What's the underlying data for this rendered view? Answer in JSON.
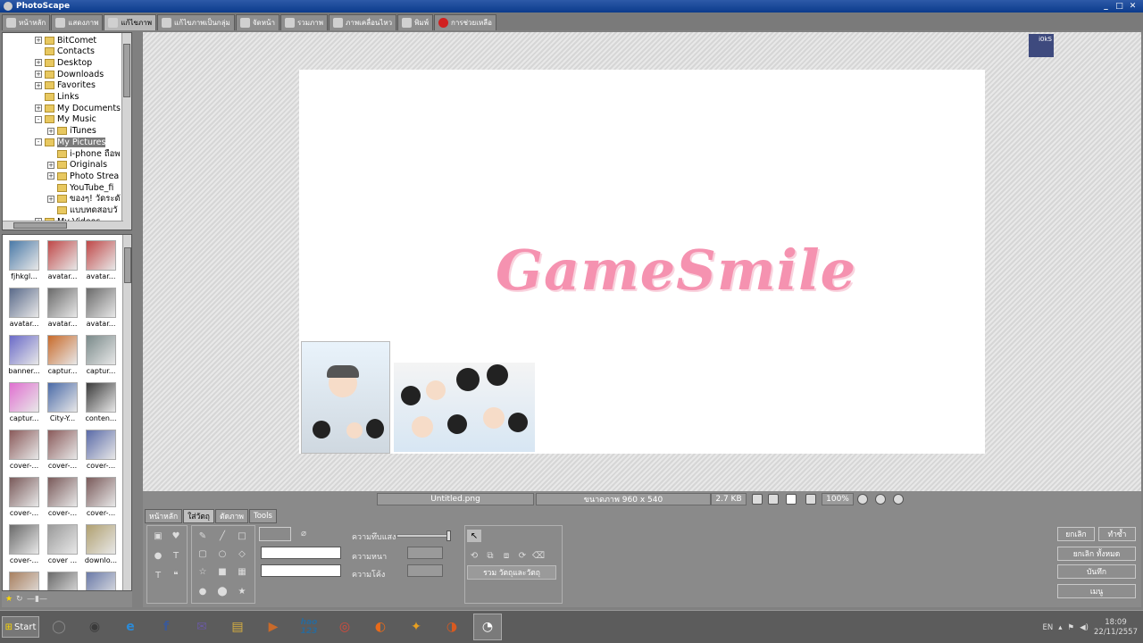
{
  "window": {
    "title": "PhotoScape",
    "controls": [
      "_",
      "□",
      "✕"
    ]
  },
  "main_tabs": [
    {
      "label": "หน้าหลัก",
      "icon": "home-icon"
    },
    {
      "label": "แสดงภาพ",
      "icon": "viewer-icon"
    },
    {
      "label": "แก้ไขภาพ",
      "icon": "editor-icon",
      "active": true
    },
    {
      "label": "แก้ไขภาพเป็นกลุ่ม",
      "icon": "batch-editor-icon"
    },
    {
      "label": "จัดหน้า",
      "icon": "page-icon"
    },
    {
      "label": "รวมภาพ",
      "icon": "combine-icon"
    },
    {
      "label": "ภาพเคลื่อนไหว",
      "icon": "animated-gif-icon"
    },
    {
      "label": "พิมพ์",
      "icon": "print-icon"
    },
    {
      "label": "การช่วยเหลือ",
      "icon": "help-icon"
    }
  ],
  "folder_tree": [
    {
      "label": "BitComet",
      "level": 1,
      "expand": "+"
    },
    {
      "label": "Contacts",
      "level": 1,
      "expand": ""
    },
    {
      "label": "Desktop",
      "level": 1,
      "expand": "+"
    },
    {
      "label": "Downloads",
      "level": 1,
      "expand": "+"
    },
    {
      "label": "Favorites",
      "level": 1,
      "expand": "+"
    },
    {
      "label": "Links",
      "level": 1,
      "expand": ""
    },
    {
      "label": "My Documents",
      "level": 1,
      "expand": "+"
    },
    {
      "label": "My Music",
      "level": 1,
      "expand": "-"
    },
    {
      "label": "iTunes",
      "level": 2,
      "expand": "+"
    },
    {
      "label": "My Pictures",
      "level": 1,
      "expand": "-",
      "selected": true
    },
    {
      "label": "i-phone ถือพ",
      "level": 2,
      "expand": ""
    },
    {
      "label": "Originals",
      "level": 2,
      "expand": "+"
    },
    {
      "label": "Photo Strea",
      "level": 2,
      "expand": "+"
    },
    {
      "label": "YouTube_fi",
      "level": 2,
      "expand": ""
    },
    {
      "label": "ของๆ! วัดระดั",
      "level": 2,
      "expand": "+"
    },
    {
      "label": "แบบทดสอบวั",
      "level": 2,
      "expand": ""
    },
    {
      "label": "My Videos",
      "level": 1,
      "expand": "+"
    }
  ],
  "thumbnails": [
    {
      "label": "fjhkgl...",
      "color": "#4a7aa8"
    },
    {
      "label": "avatar...",
      "color": "#c04848"
    },
    {
      "label": "avatar...",
      "color": "#c04848"
    },
    {
      "label": "avatar...",
      "color": "#5a6a8a"
    },
    {
      "label": "avatar...",
      "color": "#6a6a6a"
    },
    {
      "label": "avatar...",
      "color": "#6a6a6a"
    },
    {
      "label": "banner...",
      "color": "#6a6ac8"
    },
    {
      "label": "captur...",
      "color": "#c86a2a"
    },
    {
      "label": "captur...",
      "color": "#7a8a8a"
    },
    {
      "label": "captur...",
      "color": "#e070d0"
    },
    {
      "label": "City-Y...",
      "color": "#4a6aa8"
    },
    {
      "label": "conten...",
      "color": "#3a3a3a"
    },
    {
      "label": "cover-...",
      "color": "#8a5a5a"
    },
    {
      "label": "cover-...",
      "color": "#8a5a5a"
    },
    {
      "label": "cover-...",
      "color": "#5a6aa8"
    },
    {
      "label": "cover-...",
      "color": "#7a5a5a"
    },
    {
      "label": "cover-...",
      "color": "#7a5a5a"
    },
    {
      "label": "cover-...",
      "color": "#7a5a5a"
    },
    {
      "label": "cover-...",
      "color": "#6a6a6a"
    },
    {
      "label": "cover ...",
      "color": "#9a9a9a"
    },
    {
      "label": "downlo...",
      "color": "#b0a070"
    },
    {
      "label": "",
      "color": "#a88060"
    },
    {
      "label": "",
      "color": "#6a6a6a"
    },
    {
      "label": "",
      "color": "#6a7aa8"
    }
  ],
  "canvas": {
    "logo_text": "GameSmile",
    "logo_color": "#f592b0",
    "mini_thumb_label": "i0kS"
  },
  "statusbar": {
    "filename": "Untitled.png",
    "dimensions": "ขนาดภาพ 960 x 540",
    "filesize": "2.7 KB",
    "zoom": "100%"
  },
  "editor_tabs": [
    "หน้าหลัก",
    "ใส่วัตถุ",
    "ตัดภาพ",
    "Tools"
  ],
  "editor_tabs_active": 1,
  "object_panel": {
    "opacity_label": "ความทึบแสง",
    "thickness_label": "ความหนา",
    "roundness_label": "ความโค้ง",
    "group_button": "รวม วัตถุและวัตถุ",
    "opacity_level": 1.0
  },
  "right_buttons": {
    "undo": "ยกเลิก",
    "redo": "ทำซ้ำ",
    "undo_all": "ยกเลิก ทั้งหมด",
    "save": "บันทึก",
    "menu": "เมนู"
  },
  "taskbar": {
    "start_label": "Start",
    "apps": [
      {
        "name": "show-desktop-icon",
        "glyph": "◯",
        "color": "#8a8a8a"
      },
      {
        "name": "media-player-icon",
        "glyph": "◉",
        "color": "#3a3a3a"
      },
      {
        "name": "internet-explorer-icon",
        "glyph": "e",
        "color": "#2a8ad8"
      },
      {
        "name": "facebook-icon",
        "glyph": "f",
        "color": "#3b5998"
      },
      {
        "name": "mail-icon",
        "glyph": "✉",
        "color": "#6a5aa0"
      },
      {
        "name": "folder-icon",
        "glyph": "▤",
        "color": "#d8b040"
      },
      {
        "name": "video-player-icon",
        "glyph": "▶",
        "color": "#c86a2a"
      },
      {
        "name": "hao123-icon",
        "glyph": "hao 123",
        "color": "#2a6a9a"
      },
      {
        "name": "chrome-icon",
        "glyph": "◎",
        "color": "#d84a3a"
      },
      {
        "name": "firefox-icon",
        "glyph": "◐",
        "color": "#e86a1a"
      },
      {
        "name": "game-icon",
        "glyph": "✦",
        "color": "#e8a020"
      },
      {
        "name": "photoscape-icon",
        "glyph": "◑",
        "color": "#d85a20"
      },
      {
        "name": "photoscape-active-icon",
        "glyph": "◔",
        "color": "#ffffff",
        "active": true
      }
    ],
    "lang": "EN",
    "time": "18:09",
    "date": "22/11/2557"
  }
}
